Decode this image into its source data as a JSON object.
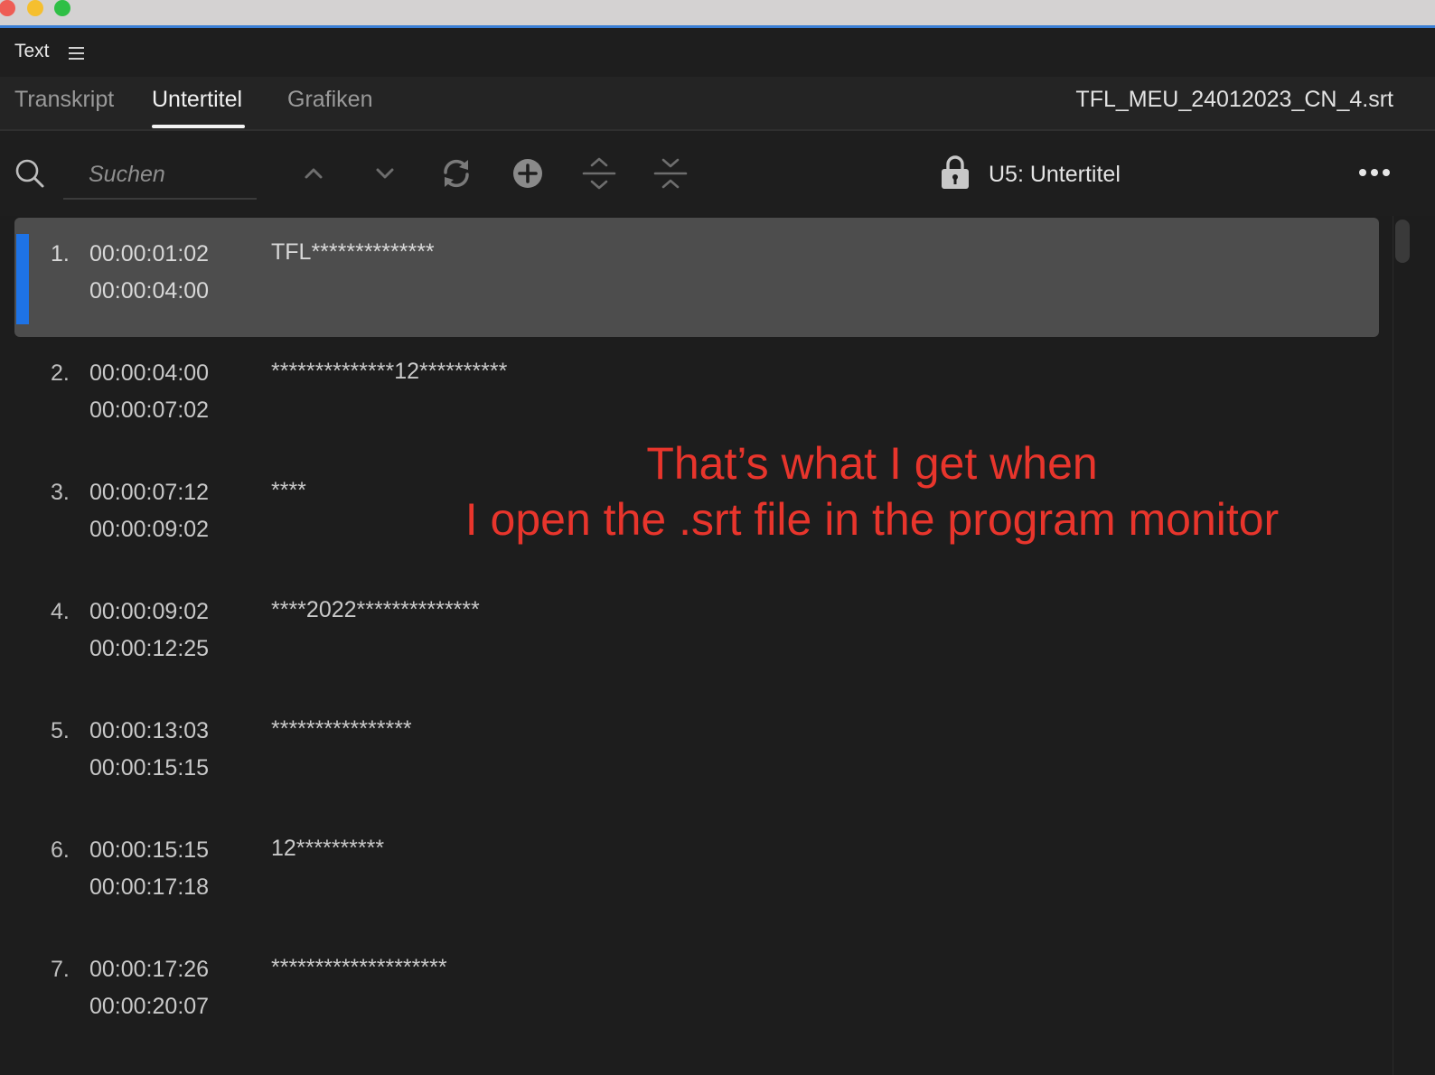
{
  "window": {
    "controls": [
      "close",
      "minimize",
      "maximize"
    ]
  },
  "panel": {
    "title": "Text",
    "menu_icon": "hamburger-icon"
  },
  "tabs": [
    {
      "label": "Transkript",
      "active": false
    },
    {
      "label": "Untertitel",
      "active": true
    },
    {
      "label": "Grafiken",
      "active": false
    }
  ],
  "filename": "TFL_MEU_24012023_CN_4.srt",
  "toolbar": {
    "search_placeholder": "Suchen",
    "icons": [
      "search-icon",
      "chevron-up-icon",
      "chevron-down-icon",
      "sync-icon",
      "add-circle-icon",
      "expand-icon",
      "collapse-icon",
      "lock-icon",
      "more-icon"
    ],
    "track_label": "U5: Untertitel"
  },
  "captions": [
    {
      "num": "1.",
      "in": "00:00:01:02",
      "out": "00:00:04:00",
      "text": "TFL**************",
      "selected": true
    },
    {
      "num": "2.",
      "in": "00:00:04:00",
      "out": "00:00:07:02",
      "text": "**************12**********",
      "selected": false
    },
    {
      "num": "3.",
      "in": "00:00:07:12",
      "out": "00:00:09:02",
      "text": "****",
      "selected": false
    },
    {
      "num": "4.",
      "in": "00:00:09:02",
      "out": "00:00:12:25",
      "text": "****2022**************",
      "selected": false
    },
    {
      "num": "5.",
      "in": "00:00:13:03",
      "out": "00:00:15:15",
      "text": "****************",
      "selected": false
    },
    {
      "num": "6.",
      "in": "00:00:15:15",
      "out": "00:00:17:18",
      "text": "12**********",
      "selected": false
    },
    {
      "num": "7.",
      "in": "00:00:17:26",
      "out": "00:00:20:07",
      "text": "********************",
      "selected": false
    }
  ],
  "annotation": {
    "line1": "That’s what I get when",
    "line2": "I open the .srt file in the program monitor",
    "color": "#e8352c"
  },
  "colors": {
    "accent": "#1e73e6",
    "selected_row": "#4d4d4d",
    "background": "#1d1d1d"
  }
}
